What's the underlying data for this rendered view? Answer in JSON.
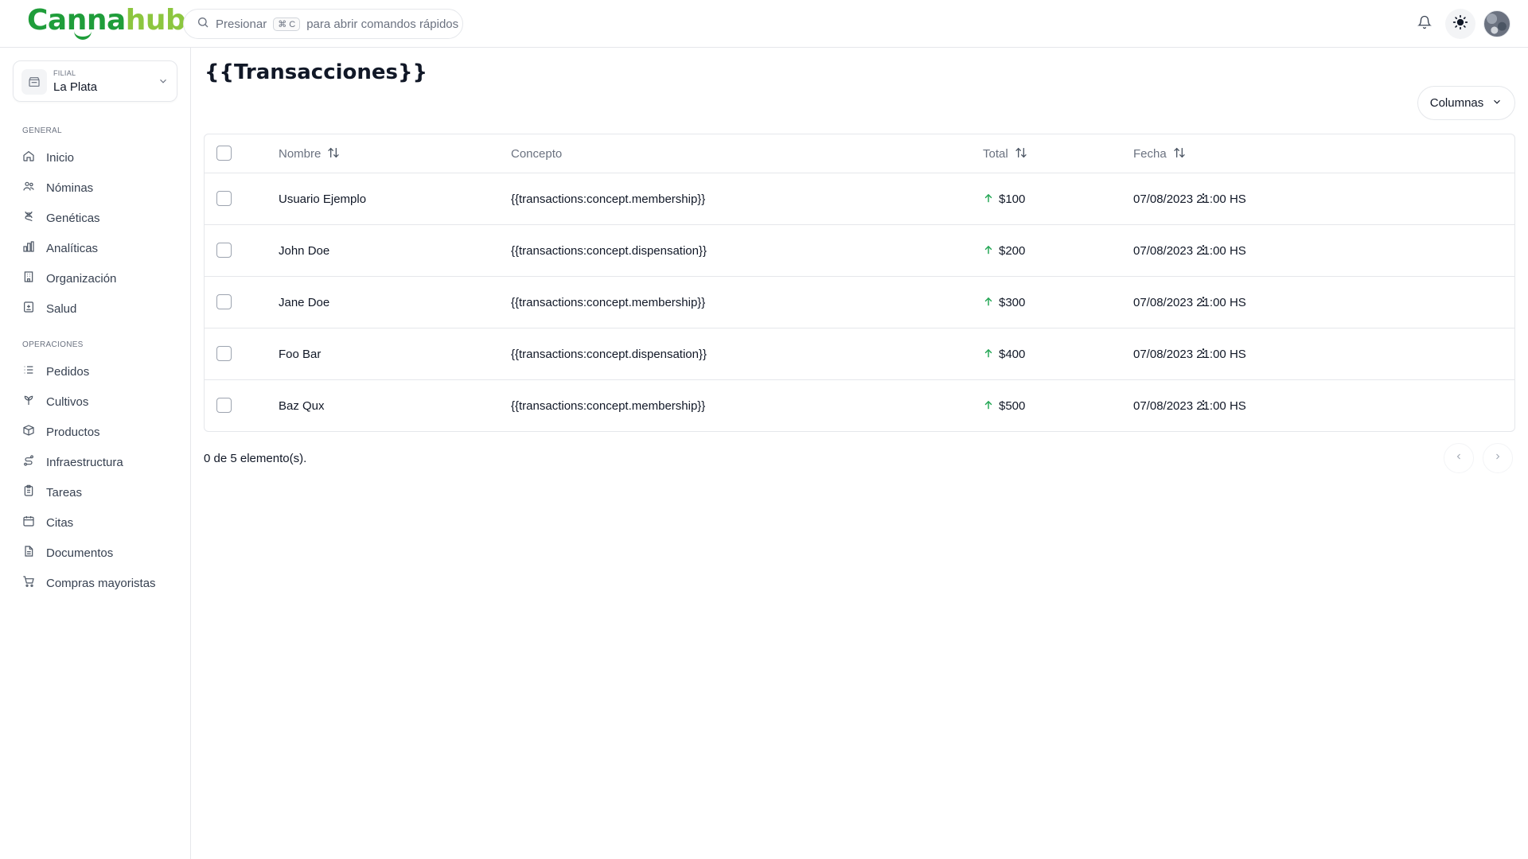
{
  "brand": {
    "part1": "Canna",
    "part2": "hub"
  },
  "search": {
    "prefix": "Presionar",
    "shortcut": "⌘ C",
    "suffix": "para abrir comandos rápidos"
  },
  "branch": {
    "label": "FILIAL",
    "value": "La Plata"
  },
  "sidebar": {
    "general_title": "GENERAL",
    "general_items": [
      {
        "label": "Inicio",
        "icon": "home-icon"
      },
      {
        "label": "Nóminas",
        "icon": "users-icon"
      },
      {
        "label": "Genéticas",
        "icon": "dna-icon"
      },
      {
        "label": "Analíticas",
        "icon": "bar-chart-icon"
      },
      {
        "label": "Organización",
        "icon": "building-icon"
      },
      {
        "label": "Salud",
        "icon": "health-icon"
      }
    ],
    "ops_title": "OPERACIONES",
    "ops_items": [
      {
        "label": "Pedidos",
        "icon": "list-icon"
      },
      {
        "label": "Cultivos",
        "icon": "sprout-icon"
      },
      {
        "label": "Productos",
        "icon": "package-icon"
      },
      {
        "label": "Infraestructura",
        "icon": "route-icon"
      },
      {
        "label": "Tareas",
        "icon": "clipboard-icon"
      },
      {
        "label": "Citas",
        "icon": "calendar-icon"
      },
      {
        "label": "Documentos",
        "icon": "file-icon"
      },
      {
        "label": "Compras mayoristas",
        "icon": "cart-icon"
      }
    ]
  },
  "page": {
    "title": "{{Transacciones}}",
    "columns_button": "Columnas"
  },
  "table": {
    "headers": {
      "name": "Nombre",
      "concept": "Concepto",
      "total": "Total",
      "date": "Fecha"
    },
    "rows": [
      {
        "name": "Usuario Ejemplo",
        "concept": "{{transactions:concept.membership}}",
        "total": "$100",
        "date": "07/08/2023 21:00 HS"
      },
      {
        "name": "John Doe",
        "concept": "{{transactions:concept.dispensation}}",
        "total": "$200",
        "date": "07/08/2023 21:00 HS"
      },
      {
        "name": "Jane Doe",
        "concept": "{{transactions:concept.membership}}",
        "total": "$300",
        "date": "07/08/2023 21:00 HS"
      },
      {
        "name": "Foo Bar",
        "concept": "{{transactions:concept.dispensation}}",
        "total": "$400",
        "date": "07/08/2023 21:00 HS"
      },
      {
        "name": "Baz Qux",
        "concept": "{{transactions:concept.membership}}",
        "total": "$500",
        "date": "07/08/2023 21:00 HS"
      }
    ],
    "footer": "0 de 5 elemento(s)."
  },
  "colors": {
    "brand_dark": "#1f9d3a",
    "brand_light": "#8cc63f",
    "positive": "#22a653"
  }
}
